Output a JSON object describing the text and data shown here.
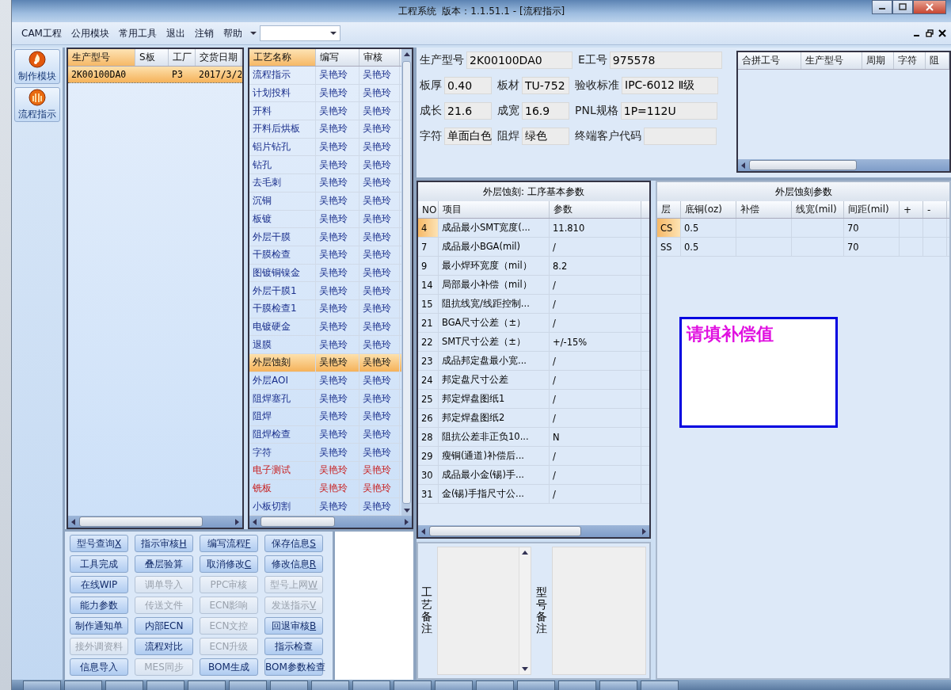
{
  "window": {
    "title": "工程系统  版本：1.1.51.1 - [流程指示]"
  },
  "menu": [
    "CAM工程",
    "公用模块",
    "常用工具",
    "退出",
    "注销",
    "帮助"
  ],
  "nav": [
    {
      "label": "制作模块",
      "kind": "flame"
    },
    {
      "label": "流程指示",
      "kind": "shell"
    }
  ],
  "products": {
    "columns": [
      {
        "label": "生产型号",
        "sorted": true
      },
      {
        "label": "S板",
        "sorted": false
      },
      {
        "label": "工厂",
        "sorted": false
      },
      {
        "label": "交货日期",
        "sorted": false
      }
    ],
    "rows": [
      {
        "cells": [
          "2K00100DA0",
          null,
          "P3",
          "2017/3/2"
        ],
        "selected": true
      }
    ]
  },
  "process": {
    "columns": [
      {
        "label": "工艺名称",
        "sorted": true
      },
      {
        "label": "编写",
        "sorted": false
      },
      {
        "label": "审核",
        "sorted": false
      }
    ],
    "rows": [
      {
        "name": "流程指示",
        "writer": "吴艳玲",
        "reviewer": "吴艳玲",
        "selected": false,
        "alert": false
      },
      {
        "name": "计划投料",
        "writer": "吴艳玲",
        "reviewer": "吴艳玲",
        "selected": false,
        "alert": false
      },
      {
        "name": "开料",
        "writer": "吴艳玲",
        "reviewer": "吴艳玲",
        "selected": false,
        "alert": false
      },
      {
        "name": "开料后烘板",
        "writer": "吴艳玲",
        "reviewer": "吴艳玲",
        "selected": false,
        "alert": false
      },
      {
        "name": "铝片钻孔",
        "writer": "吴艳玲",
        "reviewer": "吴艳玲",
        "selected": false,
        "alert": false
      },
      {
        "name": "钻孔",
        "writer": "吴艳玲",
        "reviewer": "吴艳玲",
        "selected": false,
        "alert": false
      },
      {
        "name": "去毛刺",
        "writer": "吴艳玲",
        "reviewer": "吴艳玲",
        "selected": false,
        "alert": false
      },
      {
        "name": "沉铜",
        "writer": "吴艳玲",
        "reviewer": "吴艳玲",
        "selected": false,
        "alert": false
      },
      {
        "name": "板镀",
        "writer": "吴艳玲",
        "reviewer": "吴艳玲",
        "selected": false,
        "alert": false
      },
      {
        "name": "外层干膜",
        "writer": "吴艳玲",
        "reviewer": "吴艳玲",
        "selected": false,
        "alert": false
      },
      {
        "name": "干膜检查",
        "writer": "吴艳玲",
        "reviewer": "吴艳玲",
        "selected": false,
        "alert": false
      },
      {
        "name": "图镀铜镍金",
        "writer": "吴艳玲",
        "reviewer": "吴艳玲",
        "selected": false,
        "alert": false
      },
      {
        "name": "外层干膜1",
        "writer": "吴艳玲",
        "reviewer": "吴艳玲",
        "selected": false,
        "alert": false
      },
      {
        "name": "干膜检查1",
        "writer": "吴艳玲",
        "reviewer": "吴艳玲",
        "selected": false,
        "alert": false
      },
      {
        "name": "电镀硬金",
        "writer": "吴艳玲",
        "reviewer": "吴艳玲",
        "selected": false,
        "alert": false
      },
      {
        "name": "退膜",
        "writer": "吴艳玲",
        "reviewer": "吴艳玲",
        "selected": false,
        "alert": false
      },
      {
        "name": "外层蚀刻",
        "writer": "吴艳玲",
        "reviewer": "吴艳玲",
        "selected": true,
        "alert": false
      },
      {
        "name": "外层AOI",
        "writer": "吴艳玲",
        "reviewer": "吴艳玲",
        "selected": false,
        "alert": false
      },
      {
        "name": "阻焊塞孔",
        "writer": "吴艳玲",
        "reviewer": "吴艳玲",
        "selected": false,
        "alert": false
      },
      {
        "name": "阻焊",
        "writer": "吴艳玲",
        "reviewer": "吴艳玲",
        "selected": false,
        "alert": false
      },
      {
        "name": "阻焊检查",
        "writer": "吴艳玲",
        "reviewer": "吴艳玲",
        "selected": false,
        "alert": false
      },
      {
        "name": "字符",
        "writer": "吴艳玲",
        "reviewer": "吴艳玲",
        "selected": false,
        "alert": false
      },
      {
        "name": "电子测试",
        "writer": "吴艳玲",
        "reviewer": "吴艳玲",
        "selected": false,
        "alert": true
      },
      {
        "name": "铣板",
        "writer": "吴艳玲",
        "reviewer": "吴艳玲",
        "selected": false,
        "alert": true
      },
      {
        "name": "小板切割",
        "writer": "吴艳玲",
        "reviewer": "吴艳玲",
        "selected": false,
        "alert": false
      }
    ]
  },
  "actions": [
    {
      "label": "型号查询",
      "hotkey": "X",
      "disabled": false
    },
    {
      "label": "指示审核",
      "hotkey": "H",
      "disabled": false
    },
    {
      "label": "编写流程",
      "hotkey": "F",
      "disabled": false
    },
    {
      "label": "保存信息",
      "hotkey": "S",
      "disabled": false
    },
    {
      "label": "工具完成",
      "disabled": false
    },
    {
      "label": "叠层验算",
      "disabled": false
    },
    {
      "label": "取消修改",
      "hotkey": "C",
      "disabled": false
    },
    {
      "label": "修改信息",
      "hotkey": "R",
      "disabled": false
    },
    {
      "label": "在线WIP",
      "disabled": false
    },
    {
      "label": "调单导入",
      "disabled": true
    },
    {
      "label": "PPC审核",
      "disabled": true
    },
    {
      "label": "型号上网",
      "hotkey": "W",
      "disabled": true
    },
    {
      "label": "能力参数",
      "disabled": false
    },
    {
      "label": "传送文件",
      "disabled": true
    },
    {
      "label": "ECN影响",
      "disabled": true
    },
    {
      "label": "发送指示",
      "hotkey": "V",
      "disabled": true
    },
    {
      "label": "制作通知单",
      "disabled": false
    },
    {
      "label": "内部ECN",
      "disabled": false
    },
    {
      "label": "ECN文控",
      "disabled": true
    },
    {
      "label": "回退审核",
      "hotkey": "B",
      "disabled": false
    },
    {
      "label": "接外调资料",
      "disabled": true
    },
    {
      "label": "流程对比",
      "disabled": false
    },
    {
      "label": "ECN升级",
      "disabled": true
    },
    {
      "label": "指示检查",
      "disabled": false
    },
    {
      "label": "信息导入",
      "disabled": false
    },
    {
      "label": "MES同步",
      "disabled": true
    },
    {
      "label": "BOM生成",
      "disabled": false
    },
    {
      "label": "BOM参数检查",
      "disabled": false
    }
  ],
  "info": [
    [
      {
        "label": "生产型号",
        "value": "2K00100DA0"
      },
      {
        "label": "E工号",
        "value": "975578"
      }
    ],
    [
      {
        "label": "板厚",
        "value": "0.40"
      },
      {
        "label": "板材",
        "value": "TU-752"
      },
      {
        "label": "验收标准",
        "value": "IPC-6012 Ⅱ级"
      }
    ],
    [
      {
        "label": "成长",
        "value": "21.6"
      },
      {
        "label": "成宽",
        "value": "16.9"
      },
      {
        "label": "PNL规格",
        "value": "1P=112U"
      }
    ],
    [
      {
        "label": "字符",
        "value": "单面白色"
      },
      {
        "label": "阻焊",
        "value": "绿色"
      },
      {
        "label": "终端客户代码"
      }
    ]
  ],
  "merge_table": {
    "columns": [
      "合拼工号",
      "生产型号",
      "周期",
      "字符",
      "阻"
    ]
  },
  "params": {
    "title": "外层蚀刻: 工序基本参数",
    "columns": [
      "NO",
      "项目",
      "参数"
    ],
    "rows": [
      {
        "no": "4",
        "item": "成品最小SMT宽度(...",
        "value": "11.810",
        "selected": true
      },
      {
        "no": "7",
        "item": "成品最小BGA(mil)",
        "value": "/",
        "selected": false
      },
      {
        "no": "9",
        "item": "最小焊环宽度（mil）",
        "value": "8.2",
        "selected": false
      },
      {
        "no": "14",
        "item": "局部最小补偿（mil）",
        "value": "/",
        "selected": false
      },
      {
        "no": "15",
        "item": "阻抗线宽/线距控制...",
        "value": "/",
        "selected": false
      },
      {
        "no": "21",
        "item": "BGA尺寸公差（±）",
        "value": "/",
        "selected": false
      },
      {
        "no": "22",
        "item": "SMT尺寸公差（±）",
        "value": "+/-15%",
        "selected": false
      },
      {
        "no": "23",
        "item": "成品邦定盘最小宽...",
        "value": "/",
        "selected": false
      },
      {
        "no": "24",
        "item": "邦定盘尺寸公差",
        "value": "/",
        "selected": false
      },
      {
        "no": "25",
        "item": "邦定焊盘图纸1",
        "value": "/",
        "selected": false
      },
      {
        "no": "26",
        "item": "邦定焊盘图纸2",
        "value": "/",
        "selected": false
      },
      {
        "no": "28",
        "item": "阻抗公差非正负10...",
        "value": "N",
        "selected": false
      },
      {
        "no": "29",
        "item": "瘦铜(通道)补偿后...",
        "value": "/",
        "selected": false
      },
      {
        "no": "30",
        "item": "成品最小金(锡)手...",
        "value": "/",
        "selected": false
      },
      {
        "no": "31",
        "item": "金(锡)手指尺寸公...",
        "value": "/",
        "selected": false
      }
    ]
  },
  "etch": {
    "title": "外层蚀刻参数",
    "columns": [
      "层",
      "底铜(oz)",
      "补偿",
      "线宽(mil)",
      "间距(mil)",
      "+",
      "-"
    ],
    "rows": [
      {
        "cells": [
          "CS",
          "0.5",
          null,
          null,
          "70",
          null,
          null
        ],
        "selected": true
      },
      {
        "cells": [
          "SS",
          "0.5",
          null,
          null,
          "70",
          null,
          null
        ],
        "selected": false
      }
    ]
  },
  "popup": {
    "text": "请填补偿值"
  },
  "notes": [
    {
      "label": "工艺备注"
    },
    {
      "label": "型号备注"
    }
  ]
}
